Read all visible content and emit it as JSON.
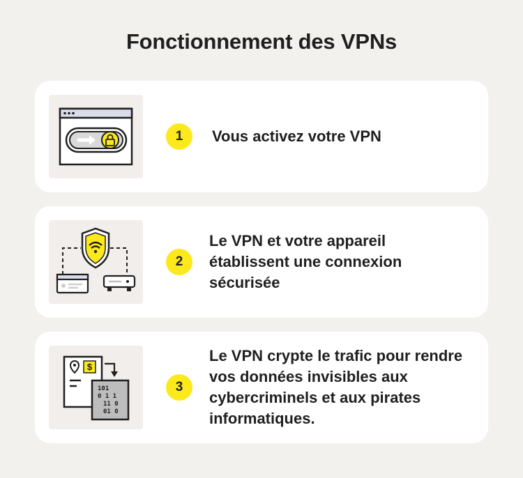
{
  "title": "Fonctionnement des VPNs",
  "accent_color": "#fce91c",
  "steps": [
    {
      "number": "1",
      "text": "Vous activez votre VPN",
      "icon": "browser-vpn-toggle-icon"
    },
    {
      "number": "2",
      "text": "Le VPN et votre appareil établissent une connexion sécurisée",
      "icon": "shield-wifi-connection-icon"
    },
    {
      "number": "3",
      "text": "Le VPN crypte le trafic pour rendre vos données invisibles aux cybercriminels et aux pirates informatiques.",
      "icon": "data-encryption-icon"
    }
  ],
  "illustration_labels": {
    "currency": "$",
    "binary_rows": [
      "101",
      "0 1 1",
      "11 0",
      "01 0"
    ]
  }
}
